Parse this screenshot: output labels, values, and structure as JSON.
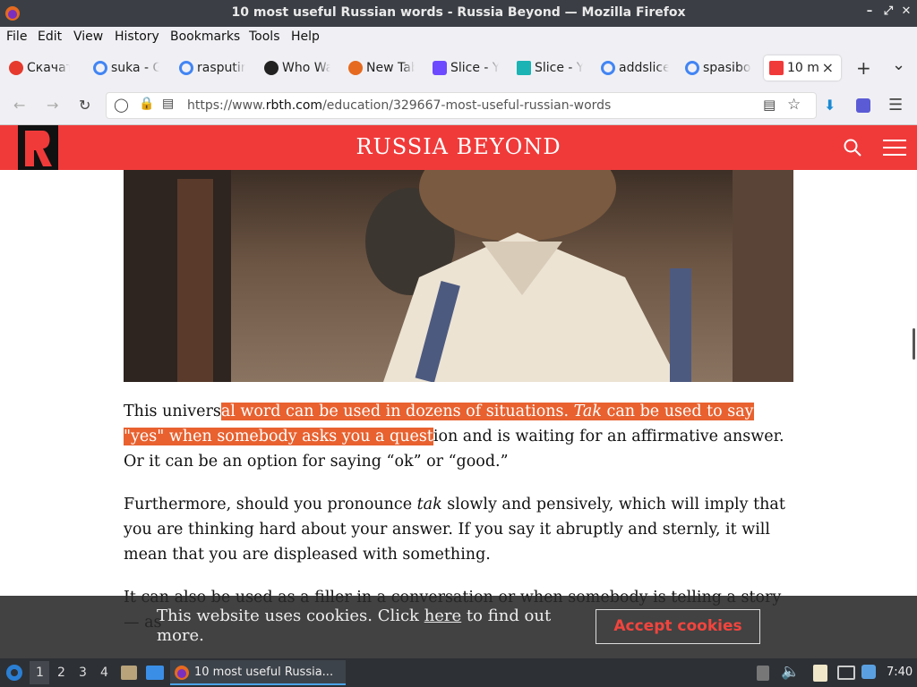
{
  "window": {
    "title": "10 most useful Russian words - Russia Beyond — Mozilla Firefox",
    "minimize_icon": "–",
    "restore_icon": "⤢",
    "close_icon": "✕"
  },
  "menu": [
    "File",
    "Edit",
    "View",
    "History",
    "Bookmarks",
    "Tools",
    "Help"
  ],
  "tabs": [
    {
      "label": "Скачат",
      "icon": "yandex-icon",
      "color": "#e63a2e"
    },
    {
      "label": "suka - G",
      "icon": "google-icon",
      "color": "#4285f4"
    },
    {
      "label": "rasputir",
      "icon": "google-icon",
      "color": "#4285f4"
    },
    {
      "label": "Who Wa",
      "icon": "amazon-icon",
      "color": "#222"
    },
    {
      "label": "New Tab",
      "icon": "firefox-icon",
      "color": "#e66a1f"
    },
    {
      "label": "Slice - Y",
      "icon": "proton-icon",
      "color": "#6d4aff"
    },
    {
      "label": "Slice - Y",
      "icon": "slice-icon",
      "color": "#1bb3b3"
    },
    {
      "label": "addslice",
      "icon": "google-icon",
      "color": "#4285f4"
    },
    {
      "label": "spasibo",
      "icon": "google-icon",
      "color": "#4285f4"
    },
    {
      "label": "10 m",
      "icon": "rbth-icon",
      "color": "#f03a3a"
    }
  ],
  "tab_close": "×",
  "new_tab": "+",
  "tab_list": "⌄",
  "url": {
    "prefix": "https://www.",
    "domain": "rbth.com",
    "path": "/education/329667-most-useful-russian-words"
  },
  "site": {
    "name": "RUSSIA BEYOND",
    "brand_color": "#f03a3a"
  },
  "article": {
    "p1_pre": "This univers",
    "p1_hl1": "al word can be used in dozens of situations. ",
    "p1_hl_em": "Tak",
    "p1_hl2": " can be used to say \"yes\" when somebody asks you a quest",
    "p1_post": "ion and is waiting for an affirmative answer. Or it can be an option for saying “ok” or “good.”",
    "p2_pre": "Furthermore, should you pronounce ",
    "p2_em": "tak",
    "p2_post": " slowly and pensively, which will imply that you are thinking hard about your answer. If you say it abruptly and sternly, it will mean that you are displeased with something.",
    "p3": "It can also be used as a filler in a conversation or when somebody is telling a story — as"
  },
  "cookie": {
    "text_pre": "This website uses cookies. Click ",
    "link": "here",
    "text_post": " to find out more.",
    "button": "Accept cookies"
  },
  "taskbar": {
    "workspaces": [
      "1",
      "2",
      "3",
      "4"
    ],
    "app_title": "10 most useful Russia...",
    "time": "7:40"
  }
}
